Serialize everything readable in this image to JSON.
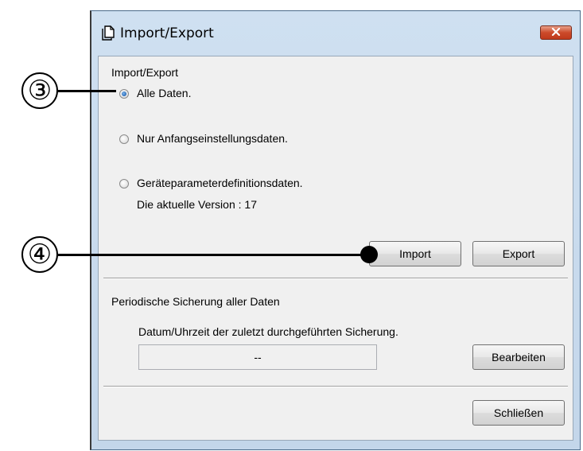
{
  "window": {
    "title": "Import/Export",
    "icon": "document-copy-icon",
    "close_icon": "close-icon"
  },
  "import_export": {
    "group_label": "Import/Export",
    "options": [
      {
        "label": "Alle Daten.",
        "checked": true
      },
      {
        "label": "Nur Anfangseinstellungsdaten.",
        "checked": false
      },
      {
        "label": "Geräteparameterdefinitionsdaten.",
        "checked": false
      }
    ],
    "version_text": "Die aktuelle Version : 17",
    "import_label": "Import",
    "export_label": "Export"
  },
  "backup": {
    "section_label": "Periodische Sicherung aller Daten",
    "last_backup_label": "Datum/Uhrzeit der zuletzt durchgeführten Sicherung.",
    "last_backup_value": "--",
    "edit_label": "Bearbeiten"
  },
  "footer": {
    "close_label": "Schließen"
  },
  "annotations": {
    "callout_3": "③",
    "callout_4": "④"
  },
  "colors": {
    "frame": "#c3d6ea",
    "client": "#f0f0f0",
    "close_button": "#c03a1c",
    "radio_selected": "#1f5fae"
  }
}
